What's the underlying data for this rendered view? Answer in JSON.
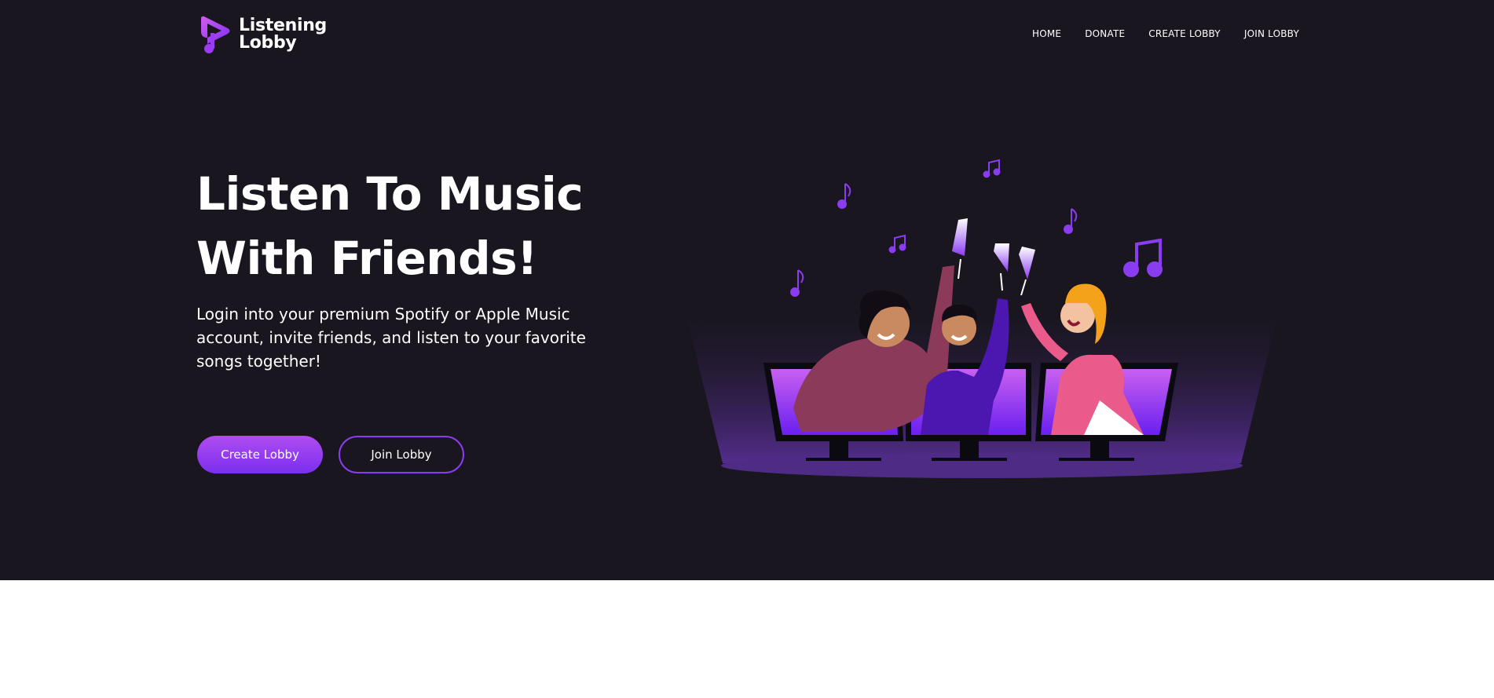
{
  "brand": {
    "name_line1": "Listening",
    "name_line2": "Lobby",
    "accent": "#9b3cf0",
    "background": "#19161f"
  },
  "nav": {
    "items": [
      {
        "label": "HOME"
      },
      {
        "label": "DONATE"
      },
      {
        "label": "CREATE LOBBY"
      },
      {
        "label": "JOIN LOBBY"
      }
    ]
  },
  "hero": {
    "headline_line1": "Listen To Music",
    "headline_line2": "With Friends!",
    "subtitle": "Login into your premium Spotify or Apple Music account, invite friends, and listen to your favorite songs together!",
    "primary_button": "Create Lobby",
    "secondary_button": "Join Lobby"
  },
  "illustration": {
    "icon": "friends-toasting-at-monitors-illustration"
  }
}
